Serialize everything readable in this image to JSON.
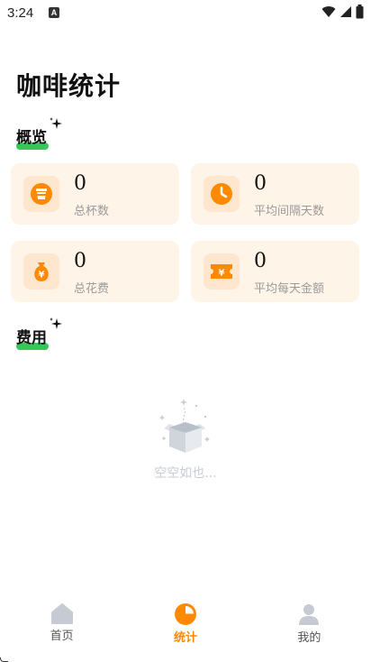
{
  "status_bar": {
    "time": "3:24",
    "notification_icon": "a-icon",
    "right_icons": [
      "wifi-icon",
      "signal-icon",
      "battery-icon"
    ]
  },
  "page": {
    "title": "咖啡统计"
  },
  "overview": {
    "heading": "概览",
    "cards": [
      {
        "value": "0",
        "label": "总杯数",
        "icon": "cup-icon"
      },
      {
        "value": "0",
        "label": "平均间隔天数",
        "icon": "clock-icon"
      },
      {
        "value": "0",
        "label": "总花费",
        "icon": "money-bag-icon"
      },
      {
        "value": "0",
        "label": "平均每天金额",
        "icon": "yen-ticket-icon"
      }
    ]
  },
  "expenses": {
    "heading": "费用",
    "empty_text": "空空如也..."
  },
  "bottom_nav": {
    "items": [
      {
        "label": "首页",
        "icon": "home-icon",
        "active": false
      },
      {
        "label": "统计",
        "icon": "pie-chart-icon",
        "active": true
      },
      {
        "label": "我的",
        "icon": "person-icon",
        "active": false
      }
    ]
  },
  "colors": {
    "accent": "#ff8a00",
    "card_bg": "#fff4e8",
    "icon_bg": "#ffe6cf",
    "highlight_green": "#34c759",
    "inactive_icon": "#c5cad3"
  }
}
